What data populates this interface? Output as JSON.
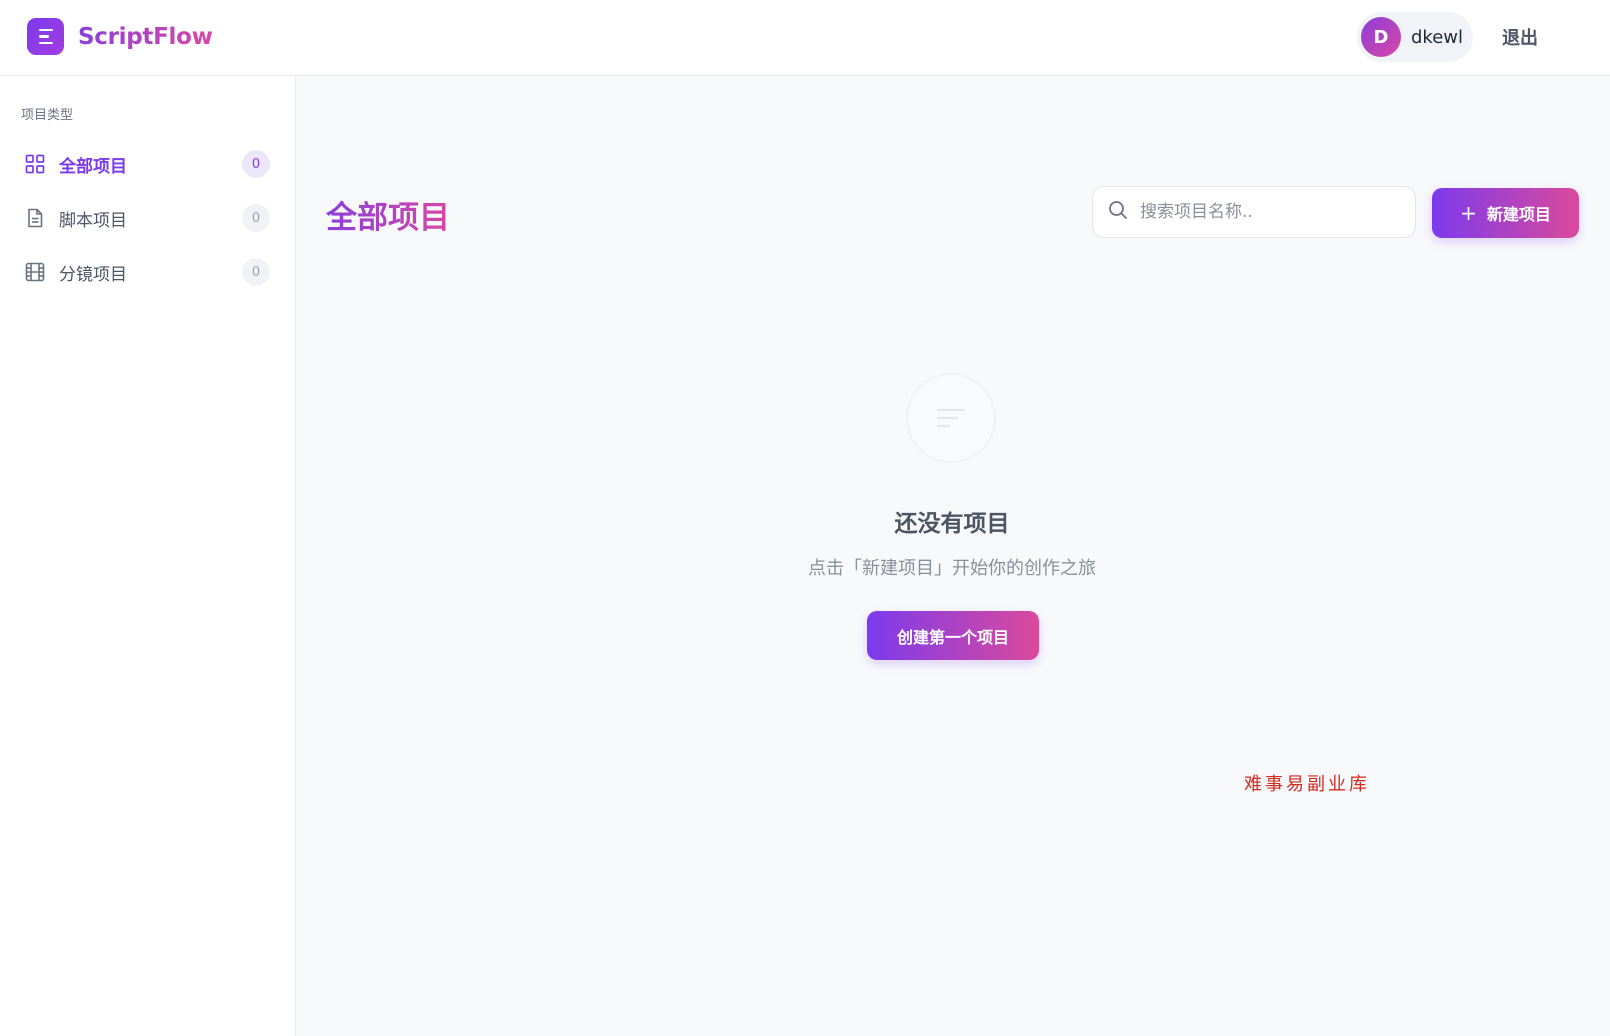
{
  "app": {
    "brand": "ScriptFlow",
    "logo_icon": "menu-lines-icon"
  },
  "header": {
    "user": {
      "avatar_initial": "D",
      "name": "dkewl"
    },
    "logout_label": "退出"
  },
  "sidebar": {
    "section_label": "项目类型",
    "items": [
      {
        "label": "全部项目",
        "count": "0",
        "icon": "grid-icon",
        "active": true
      },
      {
        "label": "脚本项目",
        "count": "0",
        "icon": "document-icon",
        "active": false
      },
      {
        "label": "分镜项目",
        "count": "0",
        "icon": "film-icon",
        "active": false
      }
    ]
  },
  "main": {
    "title": "全部项目",
    "search": {
      "placeholder": "搜索项目名称..",
      "value": ""
    },
    "new_button": {
      "icon": "+",
      "label": "新建项目"
    },
    "empty_state": {
      "icon": "empty-list-icon",
      "title": "还没有项目",
      "subtitle": "点击「新建项目」开始你的创作之旅",
      "cta_label": "创建第一个项目"
    }
  },
  "watermark": "难事易副业库",
  "colors": {
    "accent_start": "#7c3aed",
    "accent_end": "#db4a9b",
    "background": "#f8f9fb",
    "watermark": "#d62b20"
  }
}
